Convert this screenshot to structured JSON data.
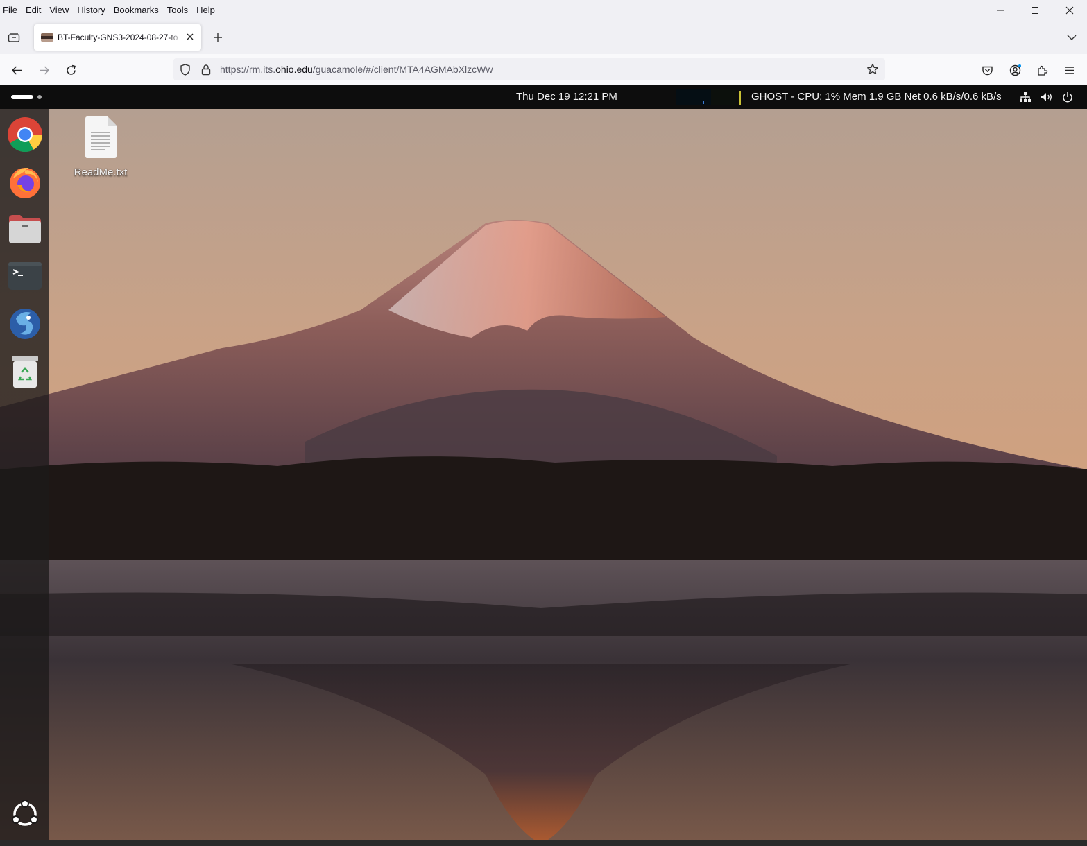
{
  "browser": {
    "menu": [
      "File",
      "Edit",
      "View",
      "History",
      "Bookmarks",
      "Tools",
      "Help"
    ],
    "tab": {
      "title": "BT-Faculty-GNS3-2024-08-27-to"
    },
    "url": {
      "prefix": "https://rm.its.",
      "host": "ohio.edu",
      "path": "/guacamole/#/client/MTA4AGMAbXlzcWw"
    }
  },
  "desktop": {
    "topbar": {
      "clock": "Thu Dec 19  12:21 PM",
      "system_monitor": "GHOST - CPU: 1% Mem 1.9 GB Net 0.6 kB/s/0.6 kB/s"
    },
    "dock_items": [
      "chrome-icon",
      "firefox-icon",
      "files-icon",
      "terminal-icon",
      "gns3-icon",
      "trash-icon",
      "show-apps-icon"
    ],
    "desktop_icons": [
      {
        "label": "ReadMe.txt"
      }
    ]
  },
  "colors": {
    "firefox_chrome": "#f0f0f4",
    "topbar": "#0d0d0d",
    "dock": "#1c1a1a",
    "sky": "#c2a18a"
  }
}
